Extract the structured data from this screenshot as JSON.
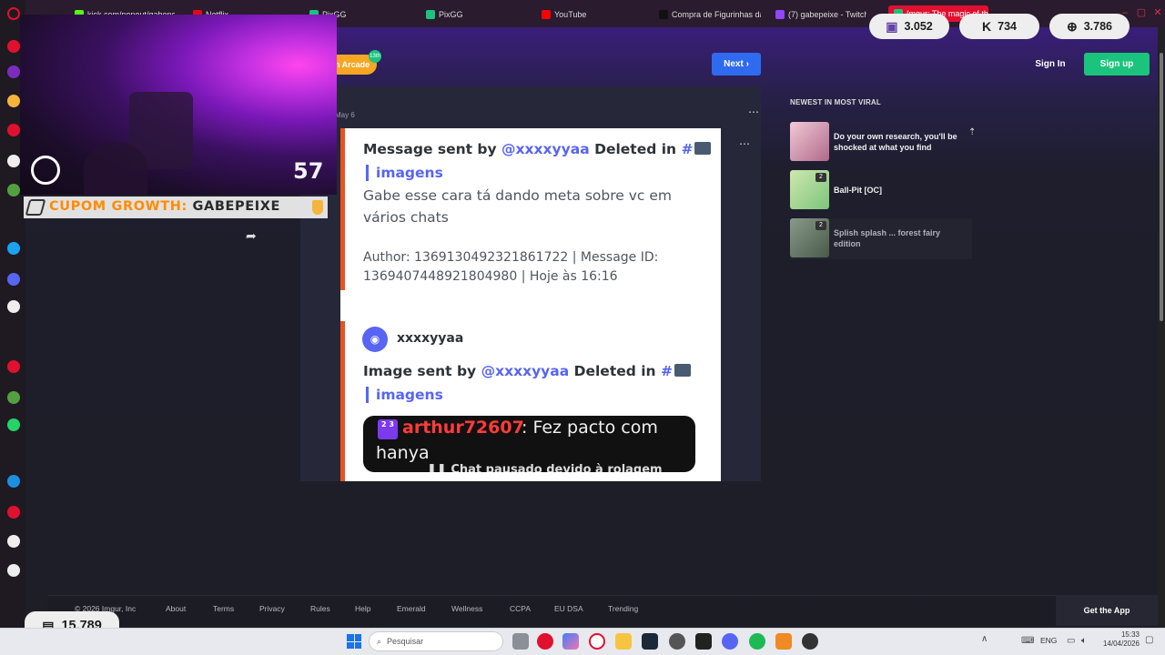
{
  "browser": {
    "tabs": [
      {
        "label": "kick.com/popout/gabepeixe"
      },
      {
        "label": "Netflix"
      },
      {
        "label": "PixGG"
      },
      {
        "label": "PixGG"
      },
      {
        "label": "YouTube"
      },
      {
        "label": "Compra de Figurinhas da"
      },
      {
        "label": "(7) gabepeixe - Twitch"
      },
      {
        "label": "Imgur: The magic of the I"
      }
    ]
  },
  "stream": {
    "webcam_counter": "57",
    "coupon_prefix": "CUPOM GROWTH:",
    "coupon_code": "GABEPEIXE",
    "stats": {
      "twitch": "3.052",
      "kick": "734",
      "web": "3.786",
      "total": "15.789"
    }
  },
  "imgur": {
    "arcade_label": "n Arcade",
    "arcade_badge": "13th",
    "next_label": "Next",
    "signin_label": "Sign In",
    "signup_label": "Sign up",
    "post_date": "May 6",
    "sidebar_title": "NEWEST IN MOST VIRAL",
    "viral": [
      {
        "title": "Do your own research, you'll be shocked at what you find",
        "count": ""
      },
      {
        "title": "Ball-Pit [OC]",
        "count": "2"
      },
      {
        "title": "Splish splash ... forest fairy edition",
        "count": "2"
      }
    ],
    "footer": {
      "copyright": "© 2026 Imgur, Inc",
      "links": [
        "About",
        "Terms",
        "Privacy",
        "Rules",
        "Help",
        "Emerald",
        "Wellness",
        "CCPA",
        "EU DSA",
        "Trending"
      ],
      "get_app": "Get the App"
    }
  },
  "discord_card": {
    "msg1_prefix": "Message sent by",
    "msg1_user": "@xxxxyyaa",
    "msg1_action": "Deleted in",
    "channel_hash": "#",
    "channel": "imagens",
    "msg1_body": "Gabe esse cara tá dando meta sobre vc em vários chats",
    "msg1_meta": "Author: 1369130492321861722 | Message ID: 1369407448921804980 | Hoje às 16:16",
    "username": "xxxxyyaa",
    "msg2_prefix": "Image sent by",
    "msg2_user": "@xxxxyyaa",
    "msg2_action": "Deleted in",
    "chat_badge": "2 3",
    "chat_user": "arthur72607",
    "chat_msg": ": Fez pacto com",
    "chat_msg2": "hanya",
    "chat_paused": "Chat pausado devido à rolagem"
  },
  "taskbar": {
    "search_placeholder": "Pesquisar",
    "lang": "ENG",
    "time": "15:33",
    "date": "14/04/2026"
  }
}
